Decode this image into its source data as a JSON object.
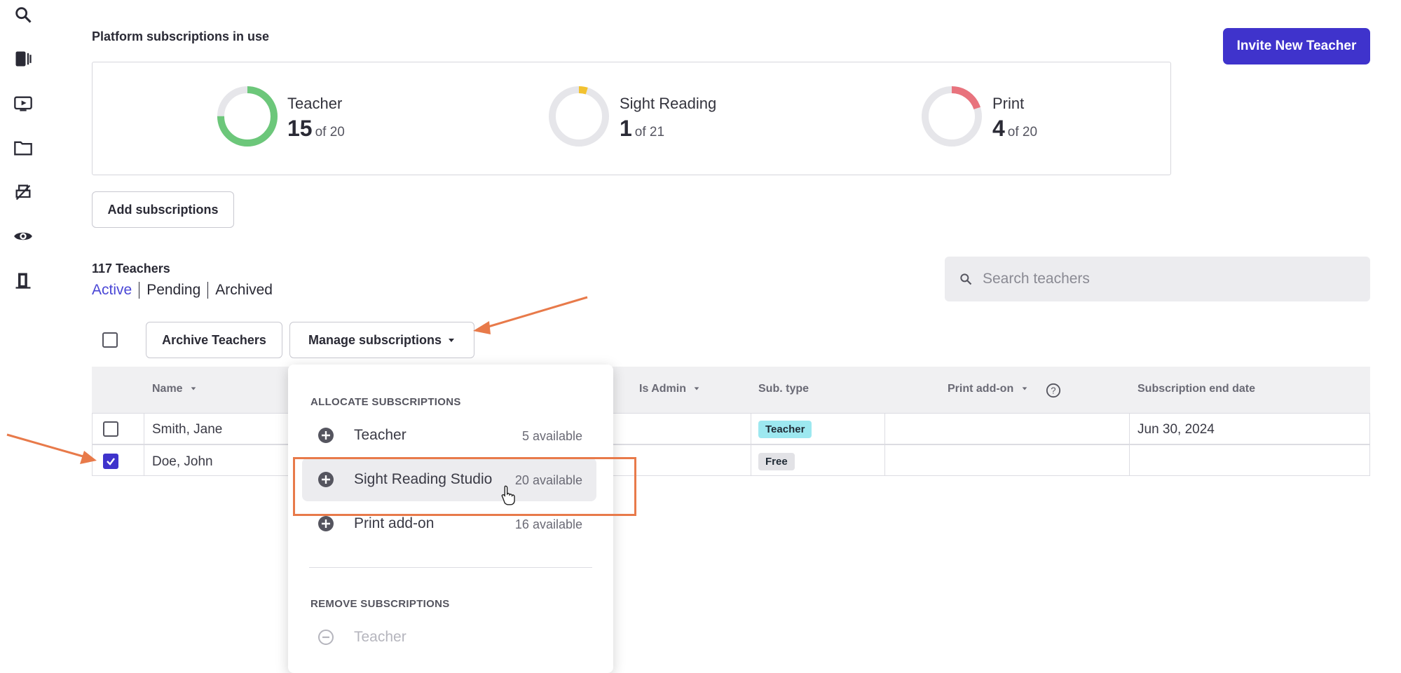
{
  "sidebar": {
    "icons": [
      "search-icon",
      "book-icon",
      "video-icon",
      "folder-icon",
      "print-icon",
      "eye-icon",
      "door-exit-icon"
    ]
  },
  "subscriptions": {
    "title": "Platform subscriptions in use",
    "items": [
      {
        "label": "Teacher",
        "used": "15",
        "of_text": "of 20",
        "fraction": 0.75,
        "color": "#6cc77a"
      },
      {
        "label": "Sight Reading",
        "used": "1",
        "of_text": "of 21",
        "fraction": 0.048,
        "color": "#f2c230"
      },
      {
        "label": "Print",
        "used": "4",
        "of_text": "of 20",
        "fraction": 0.2,
        "color": "#e8737d"
      }
    ],
    "add_label": "Add subscriptions"
  },
  "header": {
    "invite_label": "Invite New Teacher"
  },
  "teachers": {
    "count_label": "117 Teachers",
    "filters": [
      "Active",
      "Pending",
      "Archived"
    ],
    "search_placeholder": "Search teachers"
  },
  "toolbar": {
    "archive_label": "Archive Teachers",
    "manage_label": "Manage subscriptions"
  },
  "table": {
    "columns": [
      "Name",
      "Is Admin",
      "Sub. type",
      "Print add-on",
      "Subscription end date"
    ],
    "rows": [
      {
        "name": "Smith, Jane",
        "checked": false,
        "sub_type": "Teacher",
        "end_date": "Jun 30, 2024"
      },
      {
        "name": "Doe, John",
        "checked": true,
        "sub_type": "Free",
        "end_date": ""
      }
    ]
  },
  "dropdown": {
    "allocate_heading": "ALLOCATE SUBSCRIPTIONS",
    "allocate_items": [
      {
        "label": "Teacher",
        "available": "5 available"
      },
      {
        "label": "Sight Reading Studio",
        "available": "20 available"
      },
      {
        "label": "Print add-on",
        "available": "16 available"
      }
    ],
    "remove_heading": "REMOVE SUBSCRIPTIONS",
    "remove_items": [
      {
        "label": "Teacher"
      }
    ]
  },
  "colors": {
    "accent": "#3f33cc",
    "link": "#4a47d6",
    "annotation": "#e87a4a",
    "teacher_badge": "#9de8f0",
    "free_badge": "#e2e2e6"
  }
}
